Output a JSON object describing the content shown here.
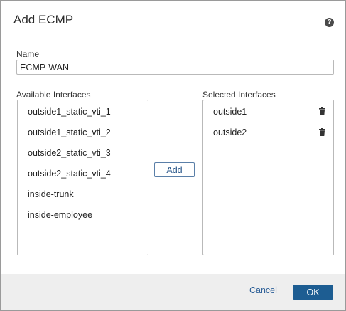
{
  "dialog": {
    "title": "Add ECMP",
    "help_icon": "question-circle-icon"
  },
  "name_field": {
    "label": "Name",
    "value": "ECMP-WAN"
  },
  "available": {
    "label": "Available Interfaces",
    "items": [
      "outside1_static_vti_1",
      "outside1_static_vti_2",
      "outside2_static_vti_3",
      "outside2_static_vti_4",
      "inside-trunk",
      "inside-employee"
    ]
  },
  "add_button": {
    "label": "Add"
  },
  "selected": {
    "label": "Selected Interfaces",
    "remove_icon": "trash-icon",
    "items": [
      "outside1",
      "outside2"
    ]
  },
  "footer": {
    "cancel_label": "Cancel",
    "ok_label": "OK"
  },
  "colors": {
    "primary_button": "#1d5d92",
    "link": "#2a5d96",
    "footer_bg": "#eeeeee"
  }
}
